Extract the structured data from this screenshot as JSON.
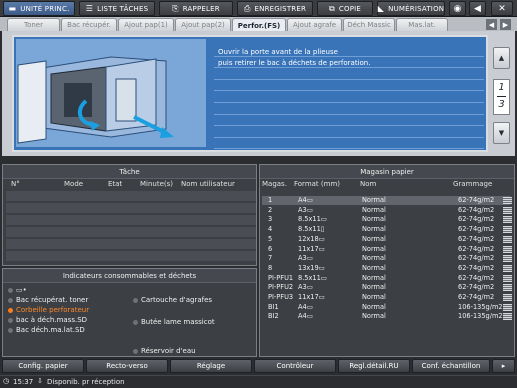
{
  "topmenu": {
    "items": [
      {
        "label": "UNITÉ PRINC.",
        "icon": "printer-icon"
      },
      {
        "label": "LISTE TÂCHES",
        "icon": "list-icon"
      },
      {
        "label": "RAPPELER",
        "icon": "recall-icon"
      },
      {
        "label": "ENREGISTRER",
        "icon": "save-icon"
      },
      {
        "label": "COPIE",
        "icon": "copy-icon"
      },
      {
        "label": "NUMÉRISATION",
        "icon": "scan-icon"
      }
    ]
  },
  "tabs": [
    {
      "label": "Toner"
    },
    {
      "label": "Bac récupér."
    },
    {
      "label": "Ajout pap(1)"
    },
    {
      "label": "Ajout pap(2)"
    },
    {
      "label": "Perfor.(FS)"
    },
    {
      "label": "Ajout agrafe"
    },
    {
      "label": "Déch Massic"
    },
    {
      "label": "Mas.lat."
    }
  ],
  "guide": {
    "message_line1": "Ouvrir la porte avant de la plieuse",
    "message_line2": "puis retirer le bac à déchets de perforation.",
    "page_current": "1",
    "page_total": "3"
  },
  "job_panel": {
    "title": "Tâche",
    "columns": [
      "N°",
      "Mode",
      "Etat",
      "Minute(s)",
      "Nom utilisateur"
    ]
  },
  "consumables": {
    "title": "Indicateurs consommables et déchets",
    "items": [
      {
        "label": "Bac récupérat. toner",
        "alert": false
      },
      {
        "label": "Corbeille perforateur",
        "alert": true
      },
      {
        "label": "bac à déch.mass.SD",
        "alert": false
      },
      {
        "label": "Bac déch.ma.lat.SD",
        "alert": false
      },
      {
        "label": "Cartouche d'agrafes",
        "alert": false
      },
      {
        "label": "Butée lame massicot",
        "alert": false
      },
      {
        "label": "Réservoir d'eau",
        "alert": false
      }
    ]
  },
  "paper_panel": {
    "title": "Magasin papier",
    "columns": [
      "Magas.",
      "Format (mm)",
      "Nom",
      "Grammage"
    ],
    "rows": [
      {
        "tray": "1",
        "format": "A4▭",
        "name": "Normal",
        "weight": "62-74g/m2"
      },
      {
        "tray": "2",
        "format": "A3▭",
        "name": "Normal",
        "weight": "62-74g/m2"
      },
      {
        "tray": "3",
        "format": "8.5x11▭",
        "name": "Normal",
        "weight": "62-74g/m2"
      },
      {
        "tray": "4",
        "format": "8.5x11▯",
        "name": "Normal",
        "weight": "62-74g/m2"
      },
      {
        "tray": "5",
        "format": "12x18▭",
        "name": "Normal",
        "weight": "62-74g/m2"
      },
      {
        "tray": "6",
        "format": "11x17▭",
        "name": "Normal",
        "weight": "62-74g/m2"
      },
      {
        "tray": "7",
        "format": "A3▭",
        "name": "Normal",
        "weight": "62-74g/m2"
      },
      {
        "tray": "8",
        "format": "13x19▭",
        "name": "Normal",
        "weight": "62-74g/m2"
      },
      {
        "tray": "PI-PFU1",
        "format": "8.5x11▭",
        "name": "Normal",
        "weight": "62-74g/m2"
      },
      {
        "tray": "PI-PFU2",
        "format": "A3▭",
        "name": "Normal",
        "weight": "62-74g/m2"
      },
      {
        "tray": "PI-PFU3",
        "format": "11x17▭",
        "name": "Normal",
        "weight": "62-74g/m2"
      },
      {
        "tray": "BI1",
        "format": "A4▭",
        "name": "Normal",
        "weight": "106-135g/m2"
      },
      {
        "tray": "BI2",
        "format": "A4▭",
        "name": "Normal",
        "weight": "106-135g/m2"
      }
    ]
  },
  "bottom_buttons": [
    {
      "label": "Config. papier"
    },
    {
      "label": "Recto-verso"
    },
    {
      "label": "Réglage"
    },
    {
      "label": "Contrôleur"
    },
    {
      "label": "Regl.détail.RU"
    },
    {
      "label": "Conf. échantillon"
    }
  ],
  "status": {
    "time": "15:37",
    "text": "Disponib. pr réception"
  },
  "colors": {
    "accent_blue": "#3a74b8",
    "alert_orange": "#ff7a1a"
  }
}
